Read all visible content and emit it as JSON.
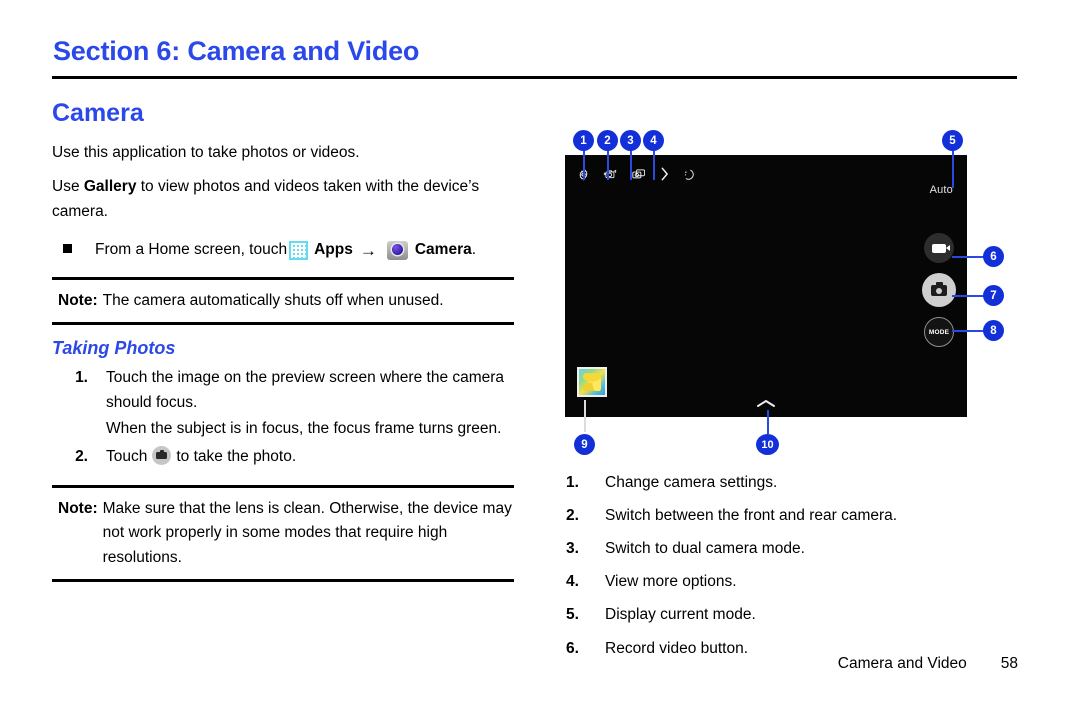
{
  "header": {
    "section_title": "Section 6: Camera and Video",
    "accent_color": "#2b48e8"
  },
  "left_column": {
    "heading": "Camera",
    "intro_1": "Use this application to take photos or videos.",
    "intro_2_pre": "Use ",
    "intro_2_bold": "Gallery",
    "intro_2_post": " to view photos and videos taken with the device’s camera.",
    "bullet": {
      "text_pre": "From a Home screen, touch",
      "apps_label": "Apps",
      "arrow": "→",
      "camera_label": "Camera",
      "period": "."
    },
    "note_1": {
      "label": "Note:",
      "text": "The camera automatically shuts off when unused."
    },
    "subheading": "Taking Photos",
    "steps": [
      {
        "num": "1.",
        "text": "Touch the image on the preview screen where the camera should focus.",
        "subtext": "When the subject is in focus, the focus frame turns green."
      },
      {
        "num": "2.",
        "text_pre": "Touch",
        "text_post": "to take the photo."
      }
    ],
    "note_2": {
      "label": "Note:",
      "text": "Make sure that the lens is clean. Otherwise, the device may not work properly in some modes that require high resolutions."
    }
  },
  "screenshot": {
    "toolbar_icons": [
      "settings-gear-icon",
      "switch-camera-icon",
      "dual-camera-icon",
      "chevron-right-icon",
      "night-mode-icon"
    ],
    "mode_label": "Auto",
    "record_button": "video-record-icon",
    "shutter_button": "camera-shutter-icon",
    "mode_button_label": "MODE",
    "gallery_thumbnail": "gallery-thumbnail-flower",
    "expand_chevron": "chevron-up-icon",
    "callouts": [
      {
        "n": "1"
      },
      {
        "n": "2"
      },
      {
        "n": "3"
      },
      {
        "n": "4"
      },
      {
        "n": "5"
      },
      {
        "n": "6"
      },
      {
        "n": "7"
      },
      {
        "n": "8"
      },
      {
        "n": "9"
      },
      {
        "n": "10"
      }
    ]
  },
  "right_list": [
    {
      "num": "1.",
      "text": "Change camera settings."
    },
    {
      "num": "2.",
      "text": "Switch between the front and rear camera."
    },
    {
      "num": "3.",
      "text": "Switch to dual camera mode."
    },
    {
      "num": "4.",
      "text": "View more options."
    },
    {
      "num": "5.",
      "text": "Display current mode."
    },
    {
      "num": "6.",
      "text": "Record video button."
    }
  ],
  "footer": {
    "chapter": "Camera and Video",
    "page_number": "58"
  }
}
